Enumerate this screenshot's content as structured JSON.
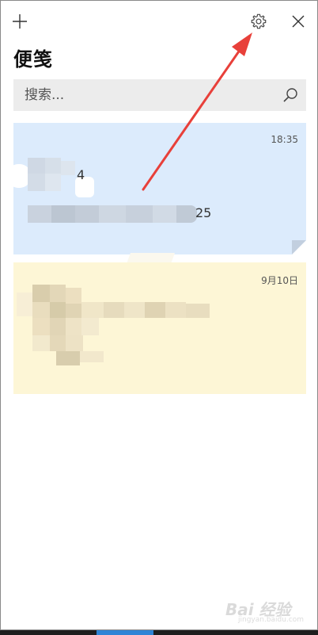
{
  "app": {
    "title": "便笺"
  },
  "toolbar": {
    "add_icon": "plus-icon",
    "settings_icon": "gear-icon",
    "close_icon": "close-icon"
  },
  "search": {
    "placeholder": "搜索...",
    "icon": "search-icon"
  },
  "notes": [
    {
      "time": "18:35",
      "color": "#dcebfc",
      "line1_visible": "4",
      "line2_visible": "25"
    },
    {
      "time": "9月10日",
      "color": "#fdf6d6",
      "line1_visible": "",
      "line2_visible": ""
    }
  ],
  "annotation": {
    "arrow_color": "#e8403a"
  },
  "watermark": {
    "text": "Bai 经验",
    "sub": "jingyan.baidu.com"
  },
  "taskbar": {
    "accent": "#2f84d6"
  }
}
